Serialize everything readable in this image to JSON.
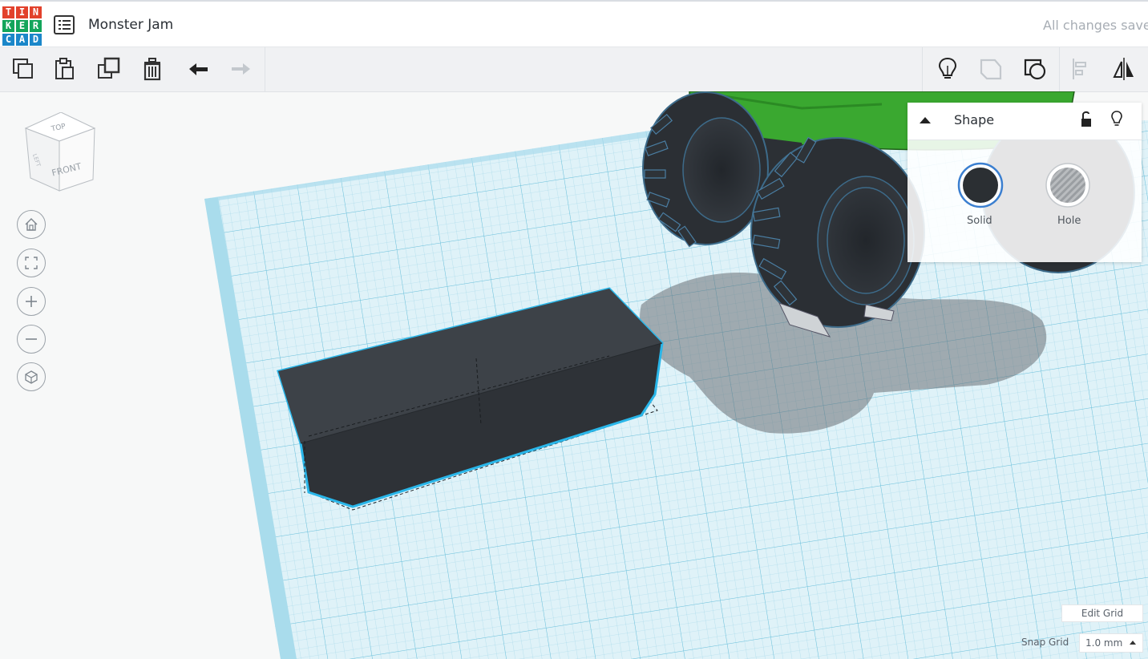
{
  "app": {
    "logo_letters": [
      "T",
      "I",
      "N",
      "K",
      "E",
      "R",
      "C",
      "A",
      "D"
    ],
    "logo_colors": [
      "#e2412c",
      "#e2412c",
      "#e2412c",
      "#13a55b",
      "#13a55b",
      "#13a55b",
      "#1b87c9",
      "#1b87c9",
      "#1b87c9"
    ],
    "project_title": "Monster Jam",
    "save_status": "All changes saved"
  },
  "toolbar": {
    "items": [
      {
        "name": "copy-icon"
      },
      {
        "name": "paste-icon"
      },
      {
        "name": "duplicate-icon"
      },
      {
        "name": "delete-icon"
      },
      {
        "name": "undo-icon"
      },
      {
        "name": "redo-icon"
      },
      {
        "name": "show-all-lightbulb-icon"
      },
      {
        "name": "group-icon"
      },
      {
        "name": "ungroup-icon"
      },
      {
        "name": "align-icon"
      },
      {
        "name": "mirror-icon"
      }
    ]
  },
  "viewcube": {
    "top_label": "TOP",
    "front_label": "FRONT",
    "side_label": "LEFT"
  },
  "view_controls": [
    {
      "name": "home-view-icon"
    },
    {
      "name": "fit-view-icon"
    },
    {
      "name": "zoom-in-icon"
    },
    {
      "name": "zoom-out-icon"
    },
    {
      "name": "orthographic-toggle-icon"
    }
  ],
  "inspector": {
    "title": "Shape",
    "solid_label": "Solid",
    "hole_label": "Hole",
    "solid_color": "#2b2f33",
    "accent_color": "#3b7fd0"
  },
  "grid": {
    "edit_label": "Edit Grid",
    "snap_label": "Snap Grid",
    "snap_value": "1.0 mm"
  },
  "colors": {
    "workplane": "#d6eef6",
    "grid_line": "#8ecfe3",
    "selected_outline": "#29b6e9",
    "truck_body": "#3aa830"
  }
}
